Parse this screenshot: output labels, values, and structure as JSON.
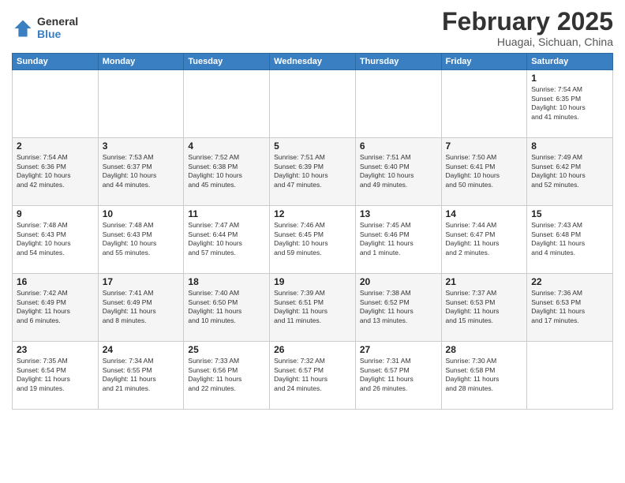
{
  "logo": {
    "general": "General",
    "blue": "Blue"
  },
  "title": {
    "month": "February 2025",
    "location": "Huagai, Sichuan, China"
  },
  "days_of_week": [
    "Sunday",
    "Monday",
    "Tuesday",
    "Wednesday",
    "Thursday",
    "Friday",
    "Saturday"
  ],
  "weeks": [
    [
      {
        "day": "",
        "info": ""
      },
      {
        "day": "",
        "info": ""
      },
      {
        "day": "",
        "info": ""
      },
      {
        "day": "",
        "info": ""
      },
      {
        "day": "",
        "info": ""
      },
      {
        "day": "",
        "info": ""
      },
      {
        "day": "1",
        "info": "Sunrise: 7:54 AM\nSunset: 6:35 PM\nDaylight: 10 hours\nand 41 minutes."
      }
    ],
    [
      {
        "day": "2",
        "info": "Sunrise: 7:54 AM\nSunset: 6:36 PM\nDaylight: 10 hours\nand 42 minutes."
      },
      {
        "day": "3",
        "info": "Sunrise: 7:53 AM\nSunset: 6:37 PM\nDaylight: 10 hours\nand 44 minutes."
      },
      {
        "day": "4",
        "info": "Sunrise: 7:52 AM\nSunset: 6:38 PM\nDaylight: 10 hours\nand 45 minutes."
      },
      {
        "day": "5",
        "info": "Sunrise: 7:51 AM\nSunset: 6:39 PM\nDaylight: 10 hours\nand 47 minutes."
      },
      {
        "day": "6",
        "info": "Sunrise: 7:51 AM\nSunset: 6:40 PM\nDaylight: 10 hours\nand 49 minutes."
      },
      {
        "day": "7",
        "info": "Sunrise: 7:50 AM\nSunset: 6:41 PM\nDaylight: 10 hours\nand 50 minutes."
      },
      {
        "day": "8",
        "info": "Sunrise: 7:49 AM\nSunset: 6:42 PM\nDaylight: 10 hours\nand 52 minutes."
      }
    ],
    [
      {
        "day": "9",
        "info": "Sunrise: 7:48 AM\nSunset: 6:43 PM\nDaylight: 10 hours\nand 54 minutes."
      },
      {
        "day": "10",
        "info": "Sunrise: 7:48 AM\nSunset: 6:43 PM\nDaylight: 10 hours\nand 55 minutes."
      },
      {
        "day": "11",
        "info": "Sunrise: 7:47 AM\nSunset: 6:44 PM\nDaylight: 10 hours\nand 57 minutes."
      },
      {
        "day": "12",
        "info": "Sunrise: 7:46 AM\nSunset: 6:45 PM\nDaylight: 10 hours\nand 59 minutes."
      },
      {
        "day": "13",
        "info": "Sunrise: 7:45 AM\nSunset: 6:46 PM\nDaylight: 11 hours\nand 1 minute."
      },
      {
        "day": "14",
        "info": "Sunrise: 7:44 AM\nSunset: 6:47 PM\nDaylight: 11 hours\nand 2 minutes."
      },
      {
        "day": "15",
        "info": "Sunrise: 7:43 AM\nSunset: 6:48 PM\nDaylight: 11 hours\nand 4 minutes."
      }
    ],
    [
      {
        "day": "16",
        "info": "Sunrise: 7:42 AM\nSunset: 6:49 PM\nDaylight: 11 hours\nand 6 minutes."
      },
      {
        "day": "17",
        "info": "Sunrise: 7:41 AM\nSunset: 6:49 PM\nDaylight: 11 hours\nand 8 minutes."
      },
      {
        "day": "18",
        "info": "Sunrise: 7:40 AM\nSunset: 6:50 PM\nDaylight: 11 hours\nand 10 minutes."
      },
      {
        "day": "19",
        "info": "Sunrise: 7:39 AM\nSunset: 6:51 PM\nDaylight: 11 hours\nand 11 minutes."
      },
      {
        "day": "20",
        "info": "Sunrise: 7:38 AM\nSunset: 6:52 PM\nDaylight: 11 hours\nand 13 minutes."
      },
      {
        "day": "21",
        "info": "Sunrise: 7:37 AM\nSunset: 6:53 PM\nDaylight: 11 hours\nand 15 minutes."
      },
      {
        "day": "22",
        "info": "Sunrise: 7:36 AM\nSunset: 6:53 PM\nDaylight: 11 hours\nand 17 minutes."
      }
    ],
    [
      {
        "day": "23",
        "info": "Sunrise: 7:35 AM\nSunset: 6:54 PM\nDaylight: 11 hours\nand 19 minutes."
      },
      {
        "day": "24",
        "info": "Sunrise: 7:34 AM\nSunset: 6:55 PM\nDaylight: 11 hours\nand 21 minutes."
      },
      {
        "day": "25",
        "info": "Sunrise: 7:33 AM\nSunset: 6:56 PM\nDaylight: 11 hours\nand 22 minutes."
      },
      {
        "day": "26",
        "info": "Sunrise: 7:32 AM\nSunset: 6:57 PM\nDaylight: 11 hours\nand 24 minutes."
      },
      {
        "day": "27",
        "info": "Sunrise: 7:31 AM\nSunset: 6:57 PM\nDaylight: 11 hours\nand 26 minutes."
      },
      {
        "day": "28",
        "info": "Sunrise: 7:30 AM\nSunset: 6:58 PM\nDaylight: 11 hours\nand 28 minutes."
      },
      {
        "day": "",
        "info": ""
      }
    ]
  ]
}
